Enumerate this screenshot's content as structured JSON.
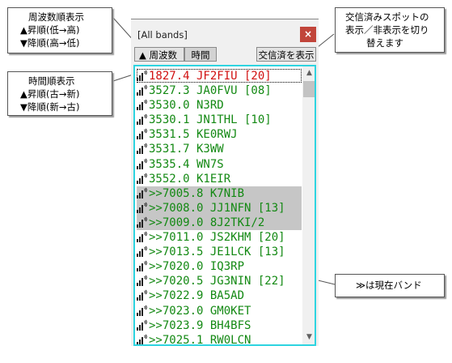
{
  "callouts": {
    "freq": [
      "周波数順表示",
      "▲昇順(低→高)",
      "▼降順(高→低)"
    ],
    "time": [
      "時間順表示",
      "▲昇順(古→新)",
      "▼降順(新→古)"
    ],
    "toggle": [
      "交信済みスポットの",
      "表示／非表示を切り",
      "替えます"
    ],
    "band": "≫は現在バンド"
  },
  "window": {
    "title": "[All bands]",
    "close_glyph": "×",
    "buttons": {
      "freq_sort": "▲ 周波数",
      "time_sort": "時間",
      "show_worked": "交信済を表示"
    }
  },
  "spots": [
    {
      "text": "1827.4 JF2FIU [20]",
      "color": "red",
      "selected": false
    },
    {
      "text": "3527.3 JA0FVU [08]",
      "color": "green",
      "selected": false
    },
    {
      "text": "3530.0 N3RD",
      "color": "green",
      "selected": false
    },
    {
      "text": "3530.1 JN1THL [10]",
      "color": "green",
      "selected": false
    },
    {
      "text": "3531.5 KE0RWJ",
      "color": "green",
      "selected": false
    },
    {
      "text": "3531.7 K3WW",
      "color": "green",
      "selected": false
    },
    {
      "text": "3535.4 WN7S",
      "color": "green",
      "selected": false
    },
    {
      "text": "3552.0 K1EIR",
      "color": "green",
      "selected": false
    },
    {
      "text": ">>7005.8 K7NIB",
      "color": "green",
      "selected": true
    },
    {
      "text": ">>7008.0 JJ1NFN [13]",
      "color": "green",
      "selected": true
    },
    {
      "text": ">>7009.0 8J2TKI/2",
      "color": "green",
      "selected": true
    },
    {
      "text": ">>7011.0 JS2KHM [20]",
      "color": "green",
      "selected": false
    },
    {
      "text": ">>7013.5 JE1LCK [13]",
      "color": "green",
      "selected": false
    },
    {
      "text": ">>7020.0 IQ3RP",
      "color": "green",
      "selected": false
    },
    {
      "text": ">>7020.5 JG3NIN [22]",
      "color": "green",
      "selected": false
    },
    {
      "text": ">>7022.9 BA5AD",
      "color": "green",
      "selected": false
    },
    {
      "text": ">>7023.0 GM0KET",
      "color": "green",
      "selected": false
    },
    {
      "text": ">>7023.9 BH4BFS",
      "color": "green",
      "selected": false
    },
    {
      "text": ">>7025.1 RW0LCN",
      "color": "green",
      "selected": false
    }
  ],
  "scrollbar": {
    "up": "▲",
    "down": "▼"
  },
  "icons": {
    "row": "signal-icon"
  },
  "colors": {
    "accent": "#2ed4e0",
    "spot_green": "#138913",
    "spot_red": "#d11010",
    "close": "#c1453a"
  }
}
